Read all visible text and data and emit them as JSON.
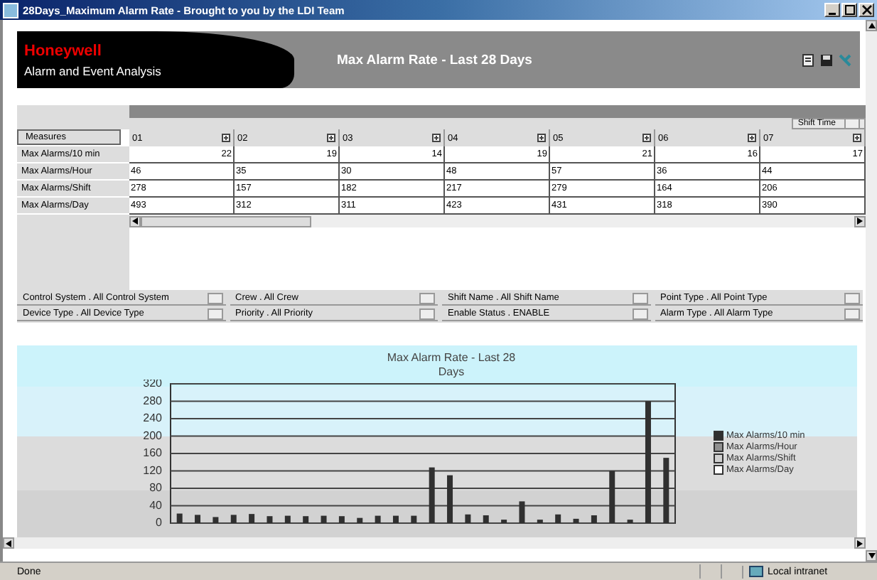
{
  "window": {
    "title": "28Days_Maximum Alarm Rate - Brought to you by the LDI Team"
  },
  "header": {
    "brand": "Honeywell",
    "subtitle": "Alarm and Event Analysis",
    "title": "Max Alarm Rate - Last 28 Days"
  },
  "shift_time": {
    "label": "Shift Time"
  },
  "table": {
    "corner": "Measures",
    "columns": [
      "01",
      "02",
      "03",
      "04",
      "05",
      "06",
      "07"
    ],
    "rows": [
      {
        "label": "Max Alarms/10 min",
        "cells": [
          "22",
          "19",
          "14",
          "19",
          "21",
          "16",
          "17"
        ]
      },
      {
        "label": "Max Alarms/Hour",
        "cells": [
          "46",
          "35",
          "30",
          "48",
          "57",
          "36",
          "44"
        ]
      },
      {
        "label": "Max Alarms/Shift",
        "cells": [
          "278",
          "157",
          "182",
          "217",
          "279",
          "164",
          "206"
        ]
      },
      {
        "label": "Max Alarms/Day",
        "cells": [
          "493",
          "312",
          "311",
          "423",
          "431",
          "318",
          "390"
        ]
      }
    ]
  },
  "filters": [
    "Control System . All Control System",
    "Crew . All Crew",
    "Shift Name . All Shift Name",
    "Point Type . All Point Type",
    "Device Type . All Device Type",
    "Priority . All Priority",
    "Enable Status . ENABLE",
    "Alarm Type . All Alarm Type"
  ],
  "chart": {
    "chart_data": {
      "type": "bar",
      "title": "Max Alarm Rate - Last 28 Days",
      "grid": true,
      "ylim": [
        0,
        320
      ],
      "yticks": [
        0,
        40,
        80,
        120,
        160,
        200,
        240,
        280,
        320
      ],
      "series": [
        {
          "name": "Max Alarms/10 min",
          "color": "#303030",
          "values": [
            22,
            19,
            14,
            19,
            21,
            16,
            17,
            16,
            17,
            16,
            12,
            17,
            17,
            17,
            128,
            110,
            20,
            18,
            8,
            50,
            8,
            20,
            10,
            18,
            120,
            8,
            280,
            150
          ]
        }
      ]
    },
    "legend": [
      {
        "label": "Max Alarms/Hour",
        "color": "#909090"
      },
      {
        "label": "Max Alarms/Shift",
        "color": "#d0d0d0"
      },
      {
        "label": "Max Alarms/Day",
        "color": "#ffffff"
      }
    ]
  },
  "status_bar": {
    "status": "Done",
    "zone": "Local intranet"
  }
}
